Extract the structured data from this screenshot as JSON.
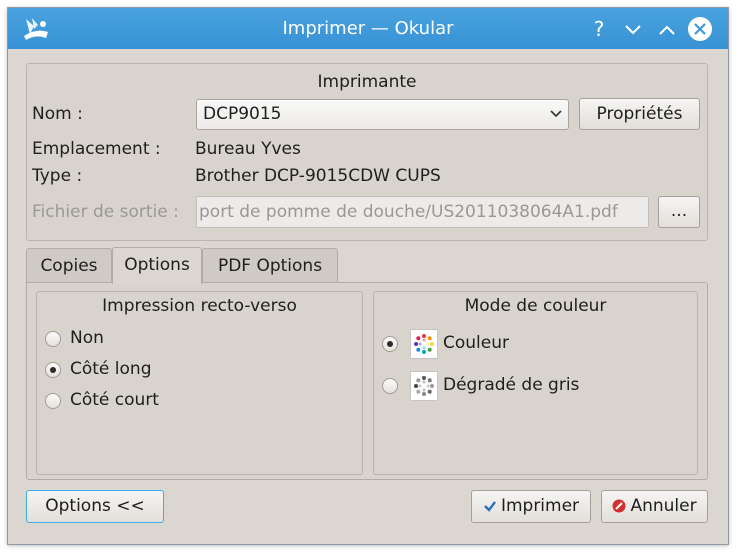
{
  "window": {
    "title": "Imprimer — Okular",
    "help_glyph": "?",
    "minimize_glyph": "⌄",
    "maximize_glyph": "⌃",
    "close_glyph": "✕"
  },
  "printer": {
    "group_title": "Imprimante",
    "name_label": "Nom :",
    "name_value": "DCP9015",
    "properties_button": "Propriétés",
    "location_label": "Emplacement :",
    "location_value": "Bureau Yves",
    "type_label": "Type :",
    "type_value": "Brother DCP-9015CDW CUPS",
    "output_file_label": "Fichier de sortie :",
    "output_file_value": "port de pomme de douche/US2011038064A1.pdf",
    "browse_button": "..."
  },
  "tabs": [
    {
      "label": "Copies",
      "active": false
    },
    {
      "label": "Options",
      "active": true
    },
    {
      "label": "PDF Options",
      "active": false
    }
  ],
  "duplex": {
    "title": "Impression recto-verso",
    "options": [
      {
        "label": "Non",
        "checked": false
      },
      {
        "label": "Côté long",
        "checked": true
      },
      {
        "label": "Côté court",
        "checked": false
      }
    ]
  },
  "color_mode": {
    "title": "Mode de couleur",
    "options": [
      {
        "label": "Couleur",
        "checked": true,
        "icon": "color-wheel-icon"
      },
      {
        "label": "Dégradé de gris",
        "checked": false,
        "icon": "grayscale-wheel-icon"
      }
    ]
  },
  "footer": {
    "options_button": "Options <<",
    "print_button": "Imprimer",
    "cancel_button": "Annuler"
  },
  "colors": {
    "titlebar": "#3d98d9",
    "window_bg": "#dbd7d0",
    "accent_focus": "#3daee9"
  }
}
